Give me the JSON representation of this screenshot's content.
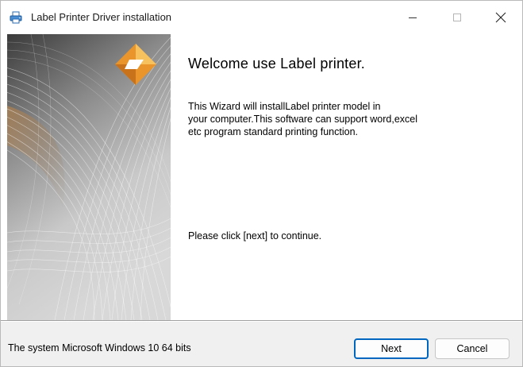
{
  "window": {
    "title": "Label Printer Driver installation",
    "icon": "printer-icon"
  },
  "title_controls": {
    "minimize": "minimize-icon",
    "maximize": "maximize-icon",
    "close": "close-icon"
  },
  "main": {
    "heading": "Welcome use Label printer.",
    "description_lines": [
      "This Wizard will installLabel printer model in",
      "your computer.This software can support word,excel",
      "etc program standard printing function."
    ],
    "continue_prompt": "Please click [next] to continue."
  },
  "footer": {
    "system_info": "The system Microsoft Windows 10 64 bits",
    "next_label": "Next",
    "cancel_label": "Cancel"
  },
  "colors": {
    "accent": "#0067c0",
    "logo_orange": "#f2a93b",
    "art_dark": "#2d2d2d"
  }
}
